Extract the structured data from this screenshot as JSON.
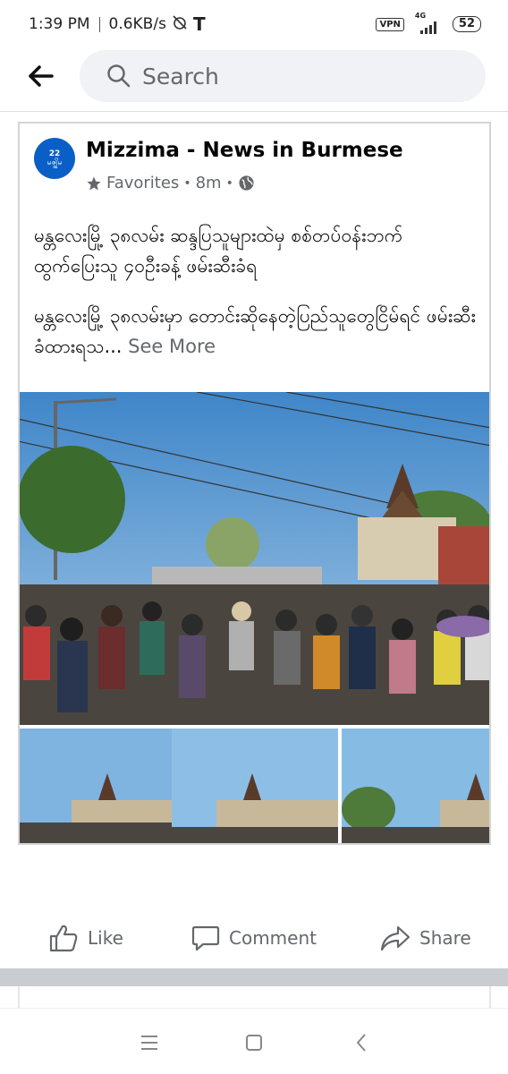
{
  "status_bar": {
    "time": "1:39 PM",
    "speed": "0.6KB/s",
    "vpn": "VPN",
    "network": "4G",
    "battery": "52"
  },
  "header": {
    "search_placeholder": "Search"
  },
  "post": {
    "page_name": "Mizzima - News in Burmese",
    "avatar_label_top": "22",
    "avatar_label_bottom": "မဇ္ဈိမ",
    "audience": "Favorites",
    "time": "8m",
    "paragraph1": "မန္တလေးမြို့ ၃၈လမ်း ဆန္ဒပြသူများထဲမှ စစ်တပ်ဝန်းဘက်ထွက်ပြေးသူ ၄၀ဦးခန့် ဖမ်းဆီးခံရ",
    "paragraph2": "မန္တလေးမြို့ ၃၈လမ်းမှာ တောင်းဆိုနေတဲ့ပြည်သူတွေငြိမ်ရင် ဖမ်းဆီးခံထားရသ...",
    "see_more": "See More"
  },
  "actions": {
    "like": "Like",
    "comment": "Comment",
    "share": "Share"
  },
  "colors": {
    "accent": "#1877f2",
    "text_secondary": "#65676b",
    "search_bg": "#f0f2f5"
  }
}
